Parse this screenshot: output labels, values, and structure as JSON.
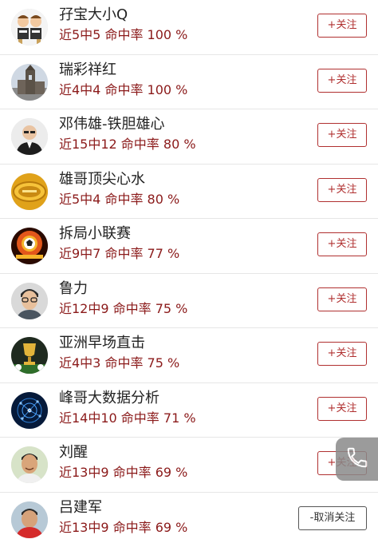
{
  "list": [
    {
      "name": "孖宝大小Q",
      "stats": "近5中5 命中率 100 %",
      "button": "+关注",
      "button_type": "follow",
      "avatar_icon": "cartoon-twins-avatar"
    },
    {
      "name": "瑞彩祥红",
      "stats": "近4中4 命中率 100 %",
      "button": "+关注",
      "button_type": "follow",
      "avatar_icon": "church-tower-avatar"
    },
    {
      "name": "邓伟雄-铁胆雄心",
      "stats": "近15中12 命中率 80 %",
      "button": "+关注",
      "button_type": "follow",
      "avatar_icon": "man-portrait-avatar"
    },
    {
      "name": "雄哥顶尖心水",
      "stats": "近5中4 命中率 80 %",
      "button": "+关注",
      "button_type": "follow",
      "avatar_icon": "gold-badge-avatar"
    },
    {
      "name": "拆局小联赛",
      "stats": "近9中7 命中率 77 %",
      "button": "+关注",
      "button_type": "follow",
      "avatar_icon": "fiery-football-avatar"
    },
    {
      "name": "鲁力",
      "stats": "近12中9 命中率 75 %",
      "button": "+关注",
      "button_type": "follow",
      "avatar_icon": "man-glasses-avatar"
    },
    {
      "name": "亚洲早场直击",
      "stats": "近4中3 命中率 75 %",
      "button": "+关注",
      "button_type": "follow",
      "avatar_icon": "trophy-avatar"
    },
    {
      "name": "峰哥大数据分析",
      "stats": "近14中10 命中率 71 %",
      "button": "+关注",
      "button_type": "follow",
      "avatar_icon": "blue-network-avatar"
    },
    {
      "name": "刘醒",
      "stats": "近13中9 命中率 69 %",
      "button": "+关注",
      "button_type": "follow",
      "avatar_icon": "man-smiling-avatar"
    },
    {
      "name": "吕建军",
      "stats": "近13中9 命中率 69 %",
      "button": "-取消关注",
      "button_type": "unfollow",
      "avatar_icon": "man-red-shirt-avatar"
    }
  ],
  "floating_button": {
    "icon": "phone-icon"
  },
  "colors": {
    "accent": "#b03030",
    "stats_text": "#8b1a1a",
    "name_text": "#222222",
    "divider": "#e6e6e6"
  }
}
